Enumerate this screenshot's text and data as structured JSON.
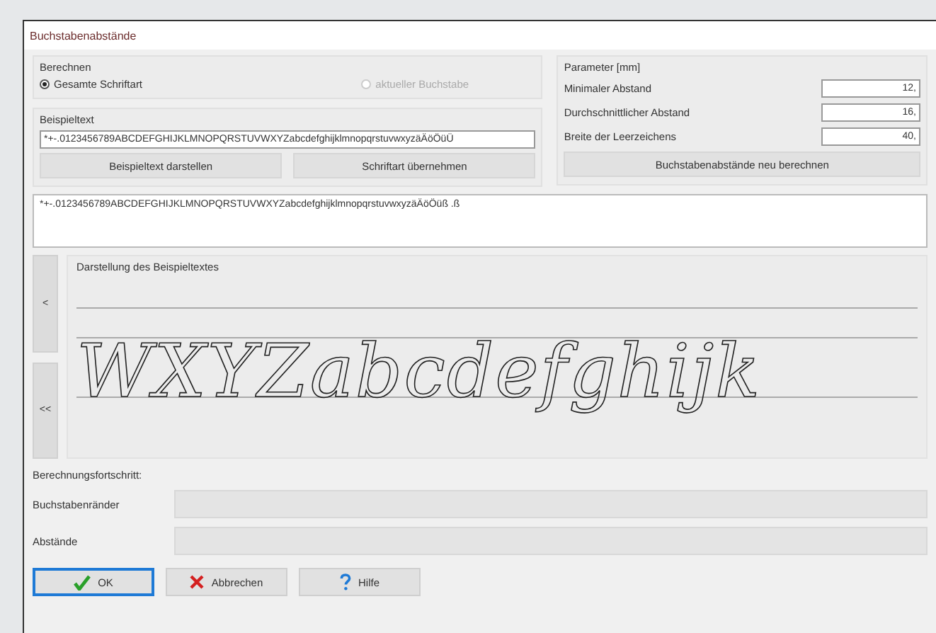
{
  "window": {
    "title": "Buchstabenabstände"
  },
  "calculate": {
    "title": "Berechnen",
    "options": [
      {
        "label": "Gesamte Schriftart",
        "selected": true,
        "disabled": false
      },
      {
        "label": "aktueller Buchstabe",
        "selected": false,
        "disabled": true
      }
    ]
  },
  "sample": {
    "label": "Beispieltext",
    "value": "*+-.0123456789ABCDEFGHIJKLMNOPQRSTUVWXYZabcdefghijklmnopqrstuvwxyzäÄöÖüÜ",
    "buttons": [
      "Beispieltext darstellen",
      "Schriftart übernehmen"
    ]
  },
  "parameters": {
    "title": "Parameter [mm]",
    "fields": [
      {
        "label": "Minimaler Abstand",
        "value": "12,"
      },
      {
        "label": "Durchschnittlicher Abstand",
        "value": "16,"
      },
      {
        "label": "Breite der Leerzeichens",
        "value": "40,"
      }
    ],
    "button": "Buchstabenabstände neu berechnen"
  },
  "output_text": "*+-.0123456789ABCDEFGHIJKLMNOPQRSTUVWXYZabcdefghijklmnopqrstuvwxyzäÄöÖüß .ß",
  "preview": {
    "title": "Darstellung des Beispieltextes",
    "text": "WXYZabcdefghijk",
    "nav_buttons": [
      "<",
      "<<"
    ]
  },
  "progress": {
    "title": "Berechnungsfortschritt:",
    "bars": [
      {
        "label": "Buchstabenränder",
        "level": 0
      },
      {
        "label": "Abstände",
        "level": 0
      }
    ]
  },
  "buttons": [
    {
      "kind": "ok",
      "label": "OK",
      "default": true
    },
    {
      "kind": "cancel",
      "label": "Abbrechen",
      "default": false
    },
    {
      "kind": "help",
      "label": "Hilfe",
      "default": false
    }
  ]
}
